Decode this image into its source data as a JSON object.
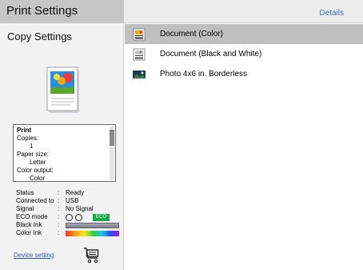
{
  "header": {
    "title": "Print Settings",
    "details": "Details"
  },
  "left": {
    "section_title": "Copy Settings",
    "print_box": {
      "title": "Print",
      "lines": [
        {
          "label": "Copies:",
          "value": "1"
        },
        {
          "label": "Paper size:",
          "value": "Letter"
        },
        {
          "label": "Color output:",
          "value": "Color"
        }
      ]
    },
    "status": {
      "status_label": "Status",
      "status_value": "Ready",
      "connected_label": "Connected to",
      "connected_value": "USB",
      "signal_label": "Signal",
      "signal_value": "No Signal",
      "eco_label": "ECO  mode",
      "eco_badge": "ECO",
      "black_ink_label": "Black Ink",
      "color_ink_label": "Color Ink",
      "colon": ":"
    },
    "device_setting": "Device setting"
  },
  "list": {
    "items": [
      {
        "label": "Document (Color)",
        "icon": "document-color-icon"
      },
      {
        "label": "Document (Black and White)",
        "icon": "document-bw-icon"
      },
      {
        "label": "Photo 4x6 in. Borderless",
        "icon": "photo-icon"
      }
    ]
  }
}
